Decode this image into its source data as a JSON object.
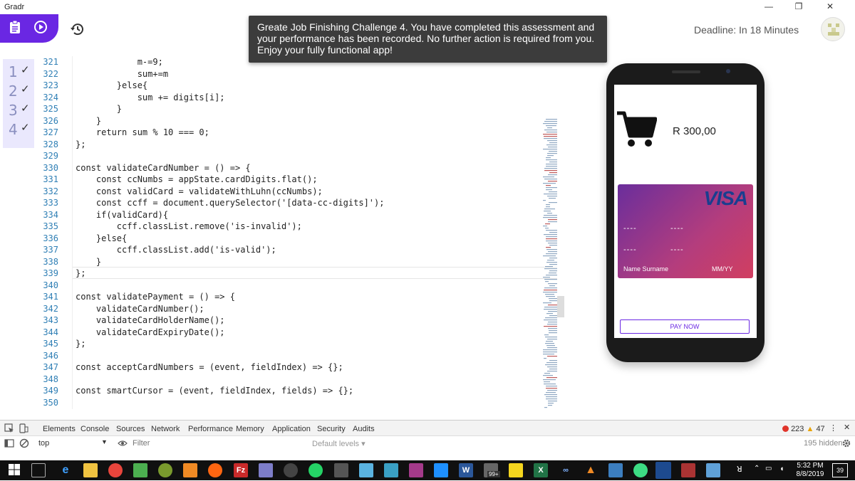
{
  "window": {
    "title": "Gradr",
    "controls": [
      "—",
      "❐",
      "✕"
    ]
  },
  "header": {
    "deadline": "Deadline: In 18 Minutes"
  },
  "toast": {
    "message": "Greate Job Finishing Challenge 4. You have completed this assessment and your performance has been recorded. No further action is required from you. Enjoy your fully functional app!"
  },
  "tasks": [
    {
      "number": "1",
      "check": "✓"
    },
    {
      "number": "2",
      "check": "✓"
    },
    {
      "number": "3",
      "check": "✓"
    },
    {
      "number": "4",
      "check": "✓"
    }
  ],
  "editor": {
    "lines": [
      {
        "n": "321",
        "code": "            m-=9;"
      },
      {
        "n": "322",
        "code": "            sum+=m"
      },
      {
        "n": "323",
        "code": "        }else{"
      },
      {
        "n": "324",
        "code": "            sum += digits[i];"
      },
      {
        "n": "325",
        "code": "        }"
      },
      {
        "n": "326",
        "code": "    }"
      },
      {
        "n": "327",
        "code": "    return sum % 10 === 0;"
      },
      {
        "n": "328",
        "code": "};"
      },
      {
        "n": "329",
        "code": ""
      },
      {
        "n": "330",
        "code": "const validateCardNumber = () => {"
      },
      {
        "n": "331",
        "code": "    const ccNumbs = appState.cardDigits.flat();"
      },
      {
        "n": "332",
        "code": "    const validCard = validateWithLuhn(ccNumbs);"
      },
      {
        "n": "333",
        "code": "    const ccff = document.querySelector('[data-cc-digits]');"
      },
      {
        "n": "334",
        "code": "    if(validCard){"
      },
      {
        "n": "335",
        "code": "        ccff.classList.remove('is-invalid');"
      },
      {
        "n": "336",
        "code": "    }else{"
      },
      {
        "n": "337",
        "code": "        ccff.classList.add('is-valid');"
      },
      {
        "n": "338",
        "code": "    }"
      },
      {
        "n": "339",
        "code": "};"
      },
      {
        "n": "340",
        "code": ""
      },
      {
        "n": "341",
        "code": "const validatePayment = () => {"
      },
      {
        "n": "342",
        "code": "    validateCardNumber();"
      },
      {
        "n": "343",
        "code": "    validateCardHolderName();"
      },
      {
        "n": "344",
        "code": "    validateCardExpiryDate();"
      },
      {
        "n": "345",
        "code": "};"
      },
      {
        "n": "346",
        "code": ""
      },
      {
        "n": "347",
        "code": "const acceptCardNumbers = (event, fieldIndex) => {};"
      },
      {
        "n": "348",
        "code": ""
      },
      {
        "n": "349",
        "code": "const smartCursor = (event, fieldIndex, fields) => {};"
      },
      {
        "n": "350",
        "code": ""
      }
    ]
  },
  "app": {
    "amount": "R 300,00",
    "card": {
      "brand": "VISA",
      "digits": [
        "----",
        "----",
        "----",
        "----"
      ],
      "holder": "Name Surname",
      "expiry": "MM/YY"
    },
    "pay_button": "PAY NOW"
  },
  "devtools": {
    "tabs": [
      "Elements",
      "Console",
      "Sources",
      "Network",
      "Performance",
      "Memory",
      "Application",
      "Security",
      "Audits"
    ],
    "active_tab": "Console",
    "errors": "223",
    "warnings": "47",
    "context": "top",
    "filter_placeholder": "Filter",
    "levels": "Default levels ▾",
    "hidden": "195 hidden"
  },
  "taskbar": {
    "time": "5:32 PM",
    "date": "8/8/2019",
    "notifications": "39",
    "badge": "99+"
  },
  "colors": {
    "accent": "#6a27e3",
    "task_bg": "#eae8fd",
    "line_number": "#2f7fb5"
  }
}
